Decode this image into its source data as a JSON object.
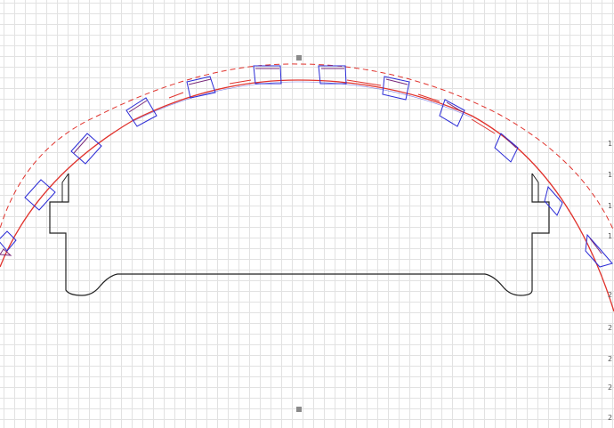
{
  "canvas": {
    "background": "#ffffff",
    "grid_color": "#e2e2e2",
    "outline_color": "#222222",
    "arc_color": "#e0322c",
    "keys_primary_color": "#2b2bd6",
    "keys_secondary_color": "#7a2a7a"
  },
  "ruler": {
    "labels": [
      "1",
      "1",
      "1",
      "1",
      "2",
      "2",
      "2",
      "2",
      "2"
    ]
  },
  "handles": [
    "selection-handle",
    "selection-handle"
  ]
}
